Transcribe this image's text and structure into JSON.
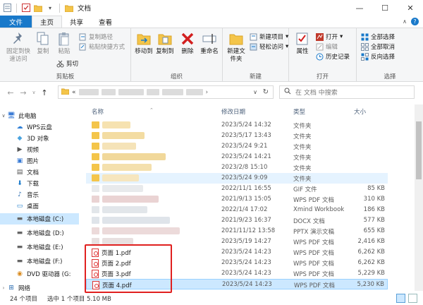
{
  "window": {
    "title": "文档"
  },
  "tabs": [
    "文件",
    "主页",
    "共享",
    "查看"
  ],
  "ribbon": {
    "clipboard": {
      "pin": "固定到快速访问",
      "copy": "复制",
      "paste": "粘贴",
      "copy_path": "复制路径",
      "paste_shortcut": "粘贴快捷方式",
      "cut": "剪切",
      "label": "剪贴板"
    },
    "organize": {
      "move_to": "移动到",
      "copy_to": "复制到",
      "delete": "删除",
      "rename": "重命名",
      "label": "组织"
    },
    "new": {
      "new_folder": "新建文件夹",
      "new_item": "新建项目",
      "easy_access": "轻松访问",
      "label": "新建"
    },
    "open": {
      "properties": "属性",
      "open": "打开",
      "edit": "编辑",
      "history": "历史记录",
      "label": "打开"
    },
    "select": {
      "select_all": "全部选择",
      "select_none": "全部取消",
      "invert": "反向选择",
      "label": "选择"
    }
  },
  "address": {
    "prefix": "«",
    "search_placeholder": "在 文档 中搜索"
  },
  "nav": [
    {
      "label": "此电脑",
      "icon": "pc-icon"
    },
    {
      "label": "WPS云盘",
      "icon": "cloud-icon"
    },
    {
      "label": "3D 对象",
      "icon": "cube-icon"
    },
    {
      "label": "视频",
      "icon": "video-icon"
    },
    {
      "label": "图片",
      "icon": "image-icon"
    },
    {
      "label": "文档",
      "icon": "document-icon"
    },
    {
      "label": "下载",
      "icon": "download-icon"
    },
    {
      "label": "音乐",
      "icon": "music-icon"
    },
    {
      "label": "桌面",
      "icon": "desktop-icon"
    },
    {
      "label": "本地磁盘 (C:)",
      "icon": "drive-icon"
    },
    {
      "label": "本地磁盘 (D:)",
      "icon": "drive-icon"
    },
    {
      "label": "本地磁盘 (E:)",
      "icon": "drive-icon"
    },
    {
      "label": "本地磁盘 (F:)",
      "icon": "drive-icon"
    },
    {
      "label": "DVD 驱动器 (G:",
      "icon": "dvd-icon"
    },
    {
      "label": "网络",
      "icon": "network-icon"
    }
  ],
  "columns": {
    "name": "名称",
    "date": "修改日期",
    "type": "类型",
    "size": "大小"
  },
  "files": [
    {
      "name": "",
      "date": "2023/5/24 14:32",
      "type": "文件夹",
      "size": ""
    },
    {
      "name": "",
      "date": "2023/5/17 13:43",
      "type": "文件夹",
      "size": ""
    },
    {
      "name": "",
      "date": "2023/5/24 9:21",
      "type": "文件夹",
      "size": ""
    },
    {
      "name": "",
      "date": "2023/5/24 14:21",
      "type": "文件夹",
      "size": ""
    },
    {
      "name": "",
      "date": "2023/2/8 15:10",
      "type": "文件夹",
      "size": ""
    },
    {
      "name": "",
      "date": "2023/5/24 9:09",
      "type": "文件夹",
      "size": ""
    },
    {
      "name": "",
      "date": "2022/11/1 16:55",
      "type": "GIF 文件",
      "size": "85 KB"
    },
    {
      "name": "",
      "date": "2021/9/13 15:05",
      "type": "WPS PDF 文档",
      "size": "310 KB"
    },
    {
      "name": "",
      "date": "2022/1/4 17:02",
      "type": "Xmind Workbook",
      "size": "186 KB"
    },
    {
      "name": "",
      "date": "2021/9/23 16:37",
      "type": "DOCX 文档",
      "size": "577 KB"
    },
    {
      "name": "",
      "date": "2021/11/12 13:58",
      "type": "PPTX 演示文稿",
      "size": "655 KB"
    },
    {
      "name": "",
      "date": "2023/5/19 14:27",
      "type": "WPS PDF 文档",
      "size": "2,416 KB"
    },
    {
      "name": "页面 1.pdf",
      "date": "2023/5/24 14:23",
      "type": "WPS PDF 文档",
      "size": "6,262 KB"
    },
    {
      "name": "页面 2.pdf",
      "date": "2023/5/24 14:23",
      "type": "WPS PDF 文档",
      "size": "6,262 KB"
    },
    {
      "name": "页面 3.pdf",
      "date": "2023/5/24 14:23",
      "type": "WPS PDF 文档",
      "size": "5,229 KB"
    },
    {
      "name": "页面 4.pdf",
      "date": "2023/5/24 14:23",
      "type": "WPS PDF 文档",
      "size": "5,230 KB"
    }
  ],
  "status": {
    "count": "24 个项目",
    "selected": "选中 1 个项目  5.10 MB"
  },
  "colors": {
    "accent": "#1979ca",
    "selection": "#cce8ff",
    "highlight_box": "#e0201f"
  }
}
